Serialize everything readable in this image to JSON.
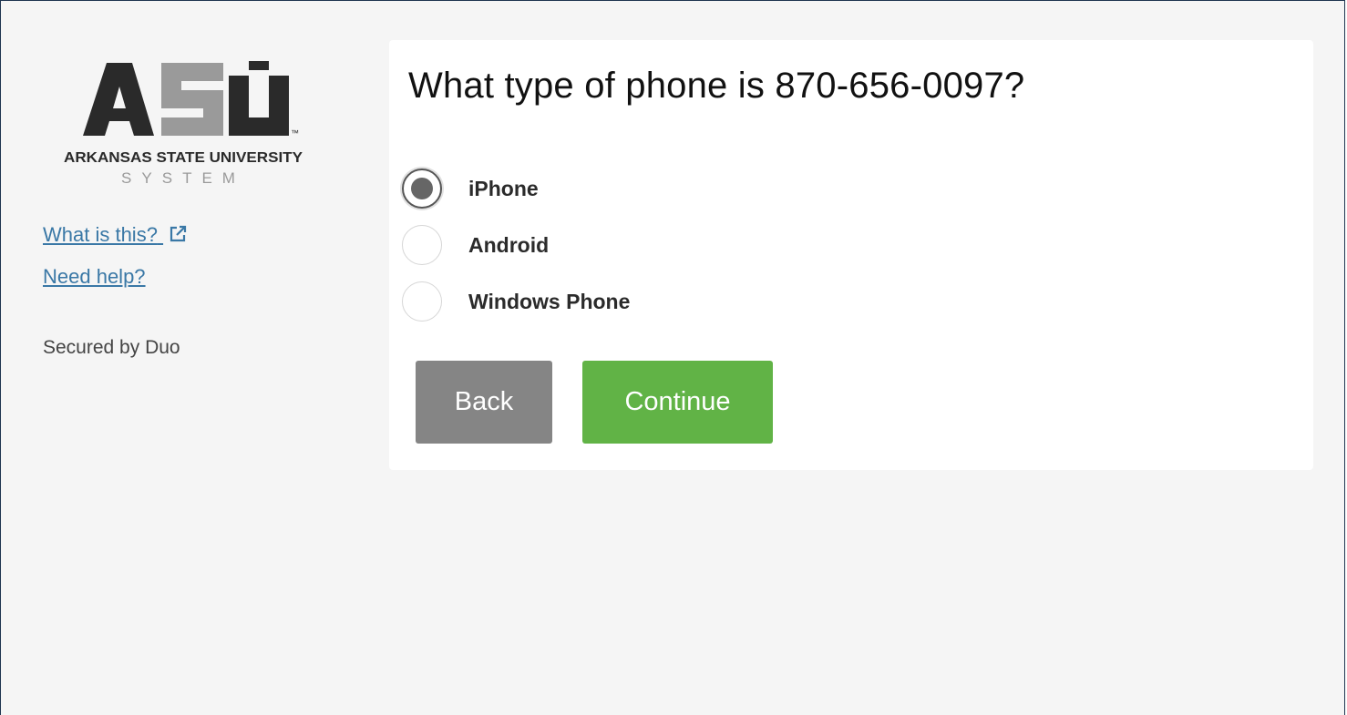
{
  "sidebar": {
    "logo": {
      "letters": "ASU",
      "tm": "™",
      "line1": "ARKANSAS STATE UNIVERSITY",
      "line2": "SYSTEM"
    },
    "links": [
      {
        "label": "What is this?",
        "icon": "external-link-icon"
      },
      {
        "label": "Need help?"
      }
    ],
    "secured_text": "Secured by Duo"
  },
  "card": {
    "question": "What type of phone is 870-656-0097?",
    "options": [
      {
        "label": "iPhone",
        "selected": true
      },
      {
        "label": "Android",
        "selected": false
      },
      {
        "label": "Windows Phone",
        "selected": false
      }
    ],
    "back_label": "Back",
    "continue_label": "Continue"
  },
  "colors": {
    "link": "#3a78a6",
    "back_button": "#858585",
    "continue_button": "#61b346",
    "background": "#f5f5f5"
  }
}
